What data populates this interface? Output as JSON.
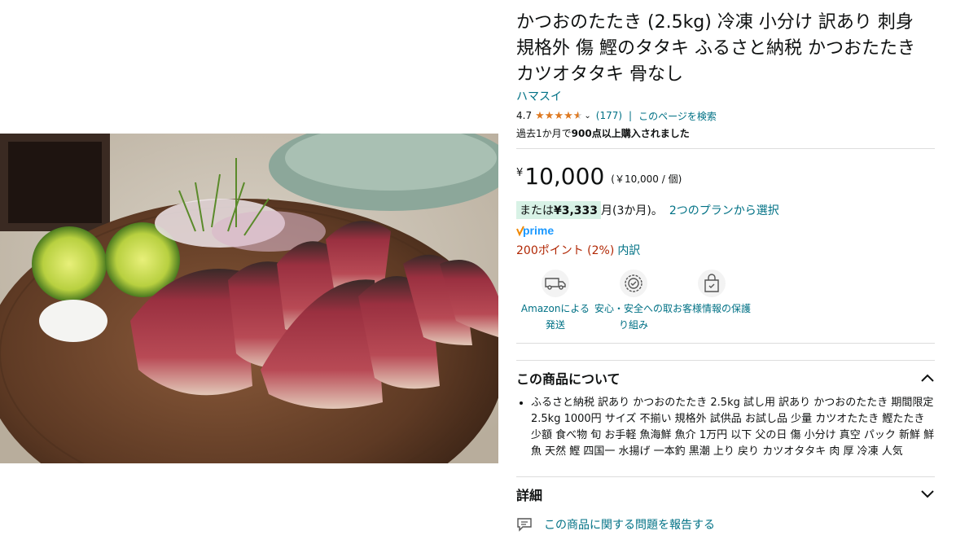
{
  "product": {
    "title": "かつおのたたき (2.5kg) 冷凍 小分け 訳あり 刺身 規格外 傷 鰹のタタキ ふるさと納税 かつおたたき カツオタタキ 骨なし",
    "brand": "ハマスイ",
    "image_icon": "seared-bonito-photo"
  },
  "rating": {
    "score": "4.7",
    "stars_value": 4.7,
    "count": "(177)",
    "separator": "|",
    "search_page": "このページを検索"
  },
  "bought_text_prefix": "過去1か月で",
  "bought_text_bold": "900点以上購入されました",
  "price": {
    "currency": "¥",
    "amount": "10,000",
    "unit_price": "(￥10,000 / 個)"
  },
  "installment": {
    "prefix": "または",
    "amount": "¥3,333",
    "suffix": "月(3か月)。",
    "plan_link": "2つのプランから選択"
  },
  "prime_label": "prime",
  "points": {
    "text": "200ポイント (2%)",
    "breakdown": "内訳"
  },
  "features": [
    {
      "icon": "truck-icon",
      "label": "Amazonによる発送"
    },
    {
      "icon": "shield-check-icon",
      "label": "安心・安全への取り組み"
    },
    {
      "icon": "secure-bag-icon",
      "label": "お客様情報の保護"
    }
  ],
  "about": {
    "heading": "この商品について",
    "bullets": [
      "ふるさと納税 訳あり かつおのたたき 2.5kg 試し用 訳あり かつおのたたき 期間限定 2.5kg 1000円 サイズ 不揃い 規格外 試供品 お試し品 少量 カツオたたき 鰹たたき 少額 食べ物 旬 お手軽 魚海鮮 魚介 1万円 以下 父の日 傷 小分け 真空 パック 新鮮 鮮魚 天然 鰹 四国一 水揚げ 一本釣 黒潮 上り 戻り カツオタタキ 肉 厚 冷凍 人気"
    ]
  },
  "details": {
    "heading": "詳細"
  },
  "report_link": "この商品に関する問題を報告する",
  "colors": {
    "link": "#007185",
    "star": "#de7921",
    "points": "#b12704",
    "installment_bg": "#d8f2e6",
    "prime": "#1a98ff"
  }
}
